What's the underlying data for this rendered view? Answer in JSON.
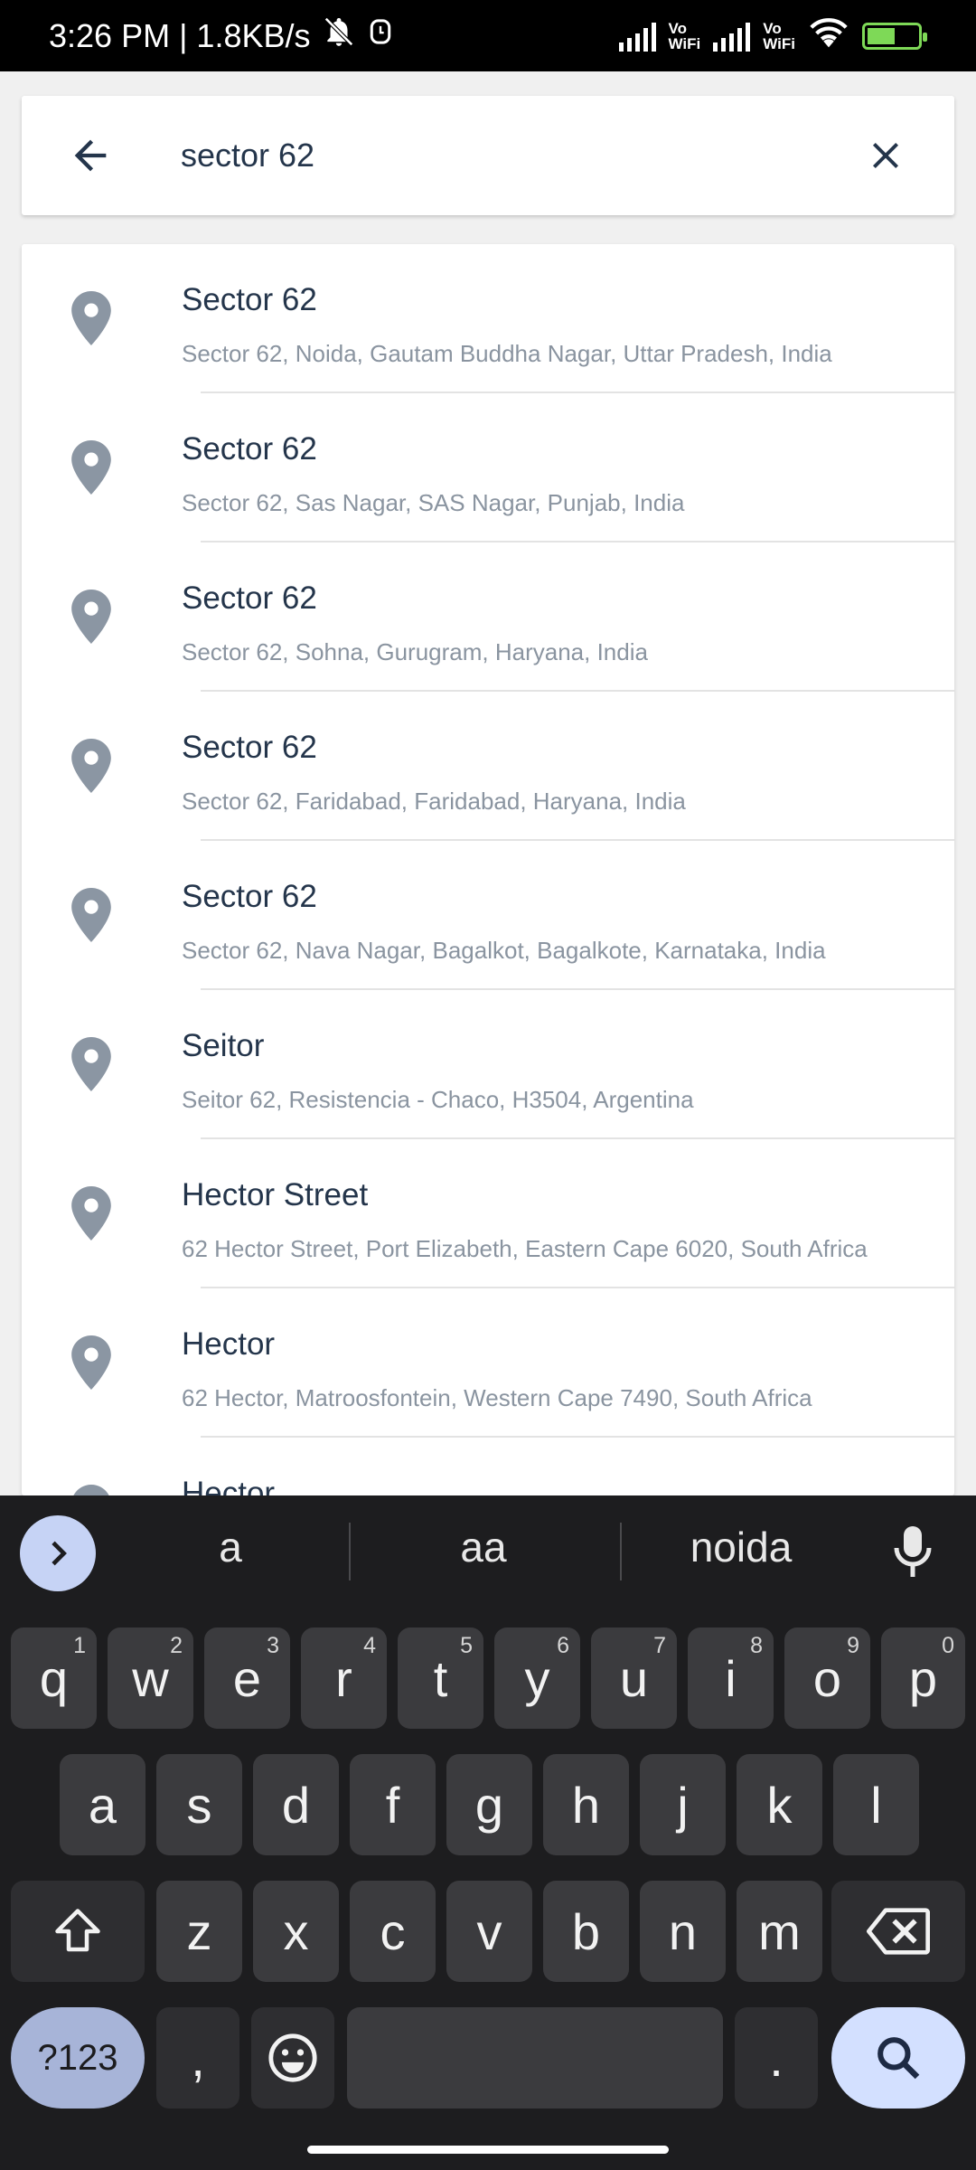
{
  "status_bar": {
    "time_network": "3:26 PM | 1.8KB/s",
    "vowifi_1": [
      "Vo",
      "WiFi"
    ],
    "vowifi_2": [
      "Vo",
      "WiFi"
    ]
  },
  "search": {
    "value": "sector 62",
    "back_icon": "arrow-left-icon",
    "clear_icon": "close-icon"
  },
  "results": [
    {
      "title": "Sector 62",
      "subtitle": "Sector 62, Noida, Gautam Buddha Nagar, Uttar Pradesh, India"
    },
    {
      "title": "Sector 62",
      "subtitle": "Sector 62, Sas Nagar, SAS Nagar, Punjab, India"
    },
    {
      "title": "Sector 62",
      "subtitle": "Sector 62, Sohna, Gurugram, Haryana, India"
    },
    {
      "title": "Sector 62",
      "subtitle": "Sector 62, Faridabad, Faridabad, Haryana, India"
    },
    {
      "title": "Sector 62",
      "subtitle": "Sector 62, Nava Nagar, Bagalkot, Bagalkote, Karnataka, India"
    },
    {
      "title": "Seitor",
      "subtitle": "Seitor 62, Resistencia - Chaco, H3504, Argentina"
    },
    {
      "title": "Hector Street",
      "subtitle": "62 Hector Street, Port Elizabeth, Eastern Cape 6020, South Africa"
    },
    {
      "title": "Hector",
      "subtitle": "62 Hector, Matroosfontein, Western Cape 7490, South Africa"
    },
    {
      "title": "Hector",
      "subtitle": ""
    }
  ],
  "keyboard": {
    "suggestions": [
      "a",
      "aa",
      "noida"
    ],
    "row1": [
      {
        "key": "q",
        "hint": "1"
      },
      {
        "key": "w",
        "hint": "2"
      },
      {
        "key": "e",
        "hint": "3"
      },
      {
        "key": "r",
        "hint": "4"
      },
      {
        "key": "t",
        "hint": "5"
      },
      {
        "key": "y",
        "hint": "6"
      },
      {
        "key": "u",
        "hint": "7"
      },
      {
        "key": "i",
        "hint": "8"
      },
      {
        "key": "o",
        "hint": "9"
      },
      {
        "key": "p",
        "hint": "0"
      }
    ],
    "row2": [
      "a",
      "s",
      "d",
      "f",
      "g",
      "h",
      "j",
      "k",
      "l"
    ],
    "row3": [
      "z",
      "x",
      "c",
      "v",
      "b",
      "n",
      "m"
    ],
    "symbols_label": "?123",
    "comma": ",",
    "period": "."
  },
  "colors": {
    "text_primary": "#24354b",
    "text_secondary": "#8a94a0",
    "pin": "#8b96a3",
    "keyboard_bg": "#1d1d1f",
    "key_bg": "#3b3b3e",
    "accent_key": "#d3e0ff"
  }
}
